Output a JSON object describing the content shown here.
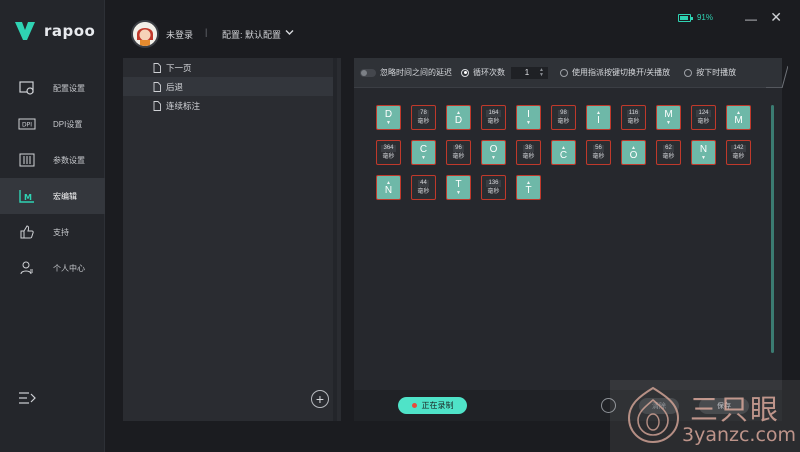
{
  "app": {
    "brand": "rapoo"
  },
  "sidebar": {
    "items": [
      {
        "label": "配置设置",
        "icon": "gear-box-icon"
      },
      {
        "label": "DPI设置",
        "icon": "dpi-icon"
      },
      {
        "label": "参数设置",
        "icon": "sliders-icon"
      },
      {
        "label": "宏编辑",
        "icon": "macro-icon",
        "active": true
      },
      {
        "label": "支持",
        "icon": "thumbs-up-icon"
      },
      {
        "label": "个人中心",
        "icon": "user-icon"
      }
    ]
  },
  "header": {
    "login_status": "未登录",
    "separator": "|",
    "profile_label": "配置: 默认配置",
    "battery_percent": "91%",
    "battery_level": 0.91,
    "minimize": "—",
    "close": "✕"
  },
  "macro_list": {
    "items": [
      {
        "label": "下一页"
      },
      {
        "label": "后退",
        "selected": true
      },
      {
        "label": "连续标注"
      }
    ],
    "add_label": "+"
  },
  "options": {
    "ignore_delay": "忽略时间之间的延迟",
    "loop_count_label": "循环次数",
    "loop_count_value": "1",
    "toggle_mode": "使用指派按键切换开/关播放",
    "hold_mode": "按下时播放"
  },
  "timeline": {
    "unit": "毫秒",
    "steps": [
      {
        "type": "key",
        "key": "D",
        "dir": "down"
      },
      {
        "type": "delay",
        "ms": "78"
      },
      {
        "type": "key",
        "key": "D",
        "dir": "up"
      },
      {
        "type": "delay",
        "ms": "164"
      },
      {
        "type": "key",
        "key": "I",
        "dir": "down"
      },
      {
        "type": "delay",
        "ms": "98"
      },
      {
        "type": "key",
        "key": "I",
        "dir": "up"
      },
      {
        "type": "delay",
        "ms": "116"
      },
      {
        "type": "key",
        "key": "M",
        "dir": "down"
      },
      {
        "type": "delay",
        "ms": "124"
      },
      {
        "type": "key",
        "key": "M",
        "dir": "up"
      },
      {
        "type": "delay",
        "ms": "364"
      },
      {
        "type": "key",
        "key": "C",
        "dir": "down"
      },
      {
        "type": "delay",
        "ms": "96"
      },
      {
        "type": "key",
        "key": "O",
        "dir": "down"
      },
      {
        "type": "delay",
        "ms": "38"
      },
      {
        "type": "key",
        "key": "C",
        "dir": "up"
      },
      {
        "type": "delay",
        "ms": "56"
      },
      {
        "type": "key",
        "key": "O",
        "dir": "up"
      },
      {
        "type": "delay",
        "ms": "62"
      },
      {
        "type": "key",
        "key": "N",
        "dir": "down"
      },
      {
        "type": "delay",
        "ms": "142"
      },
      {
        "type": "key",
        "key": "N",
        "dir": "up"
      },
      {
        "type": "delay",
        "ms": "44"
      },
      {
        "type": "key",
        "key": "T",
        "dir": "down"
      },
      {
        "type": "delay",
        "ms": "136"
      },
      {
        "type": "key",
        "key": "T",
        "dir": "up"
      }
    ]
  },
  "bottom": {
    "record_label": "正在录制",
    "clear_label": "清除",
    "save_label": "保存"
  },
  "watermark": {
    "cn": "三只眼",
    "url": "3yanzc.com"
  },
  "colors": {
    "accent": "#4fe3c8",
    "key_tile": "#6eb8a8",
    "tile_border": "#c0392b",
    "battery": "#2fd3b3"
  }
}
